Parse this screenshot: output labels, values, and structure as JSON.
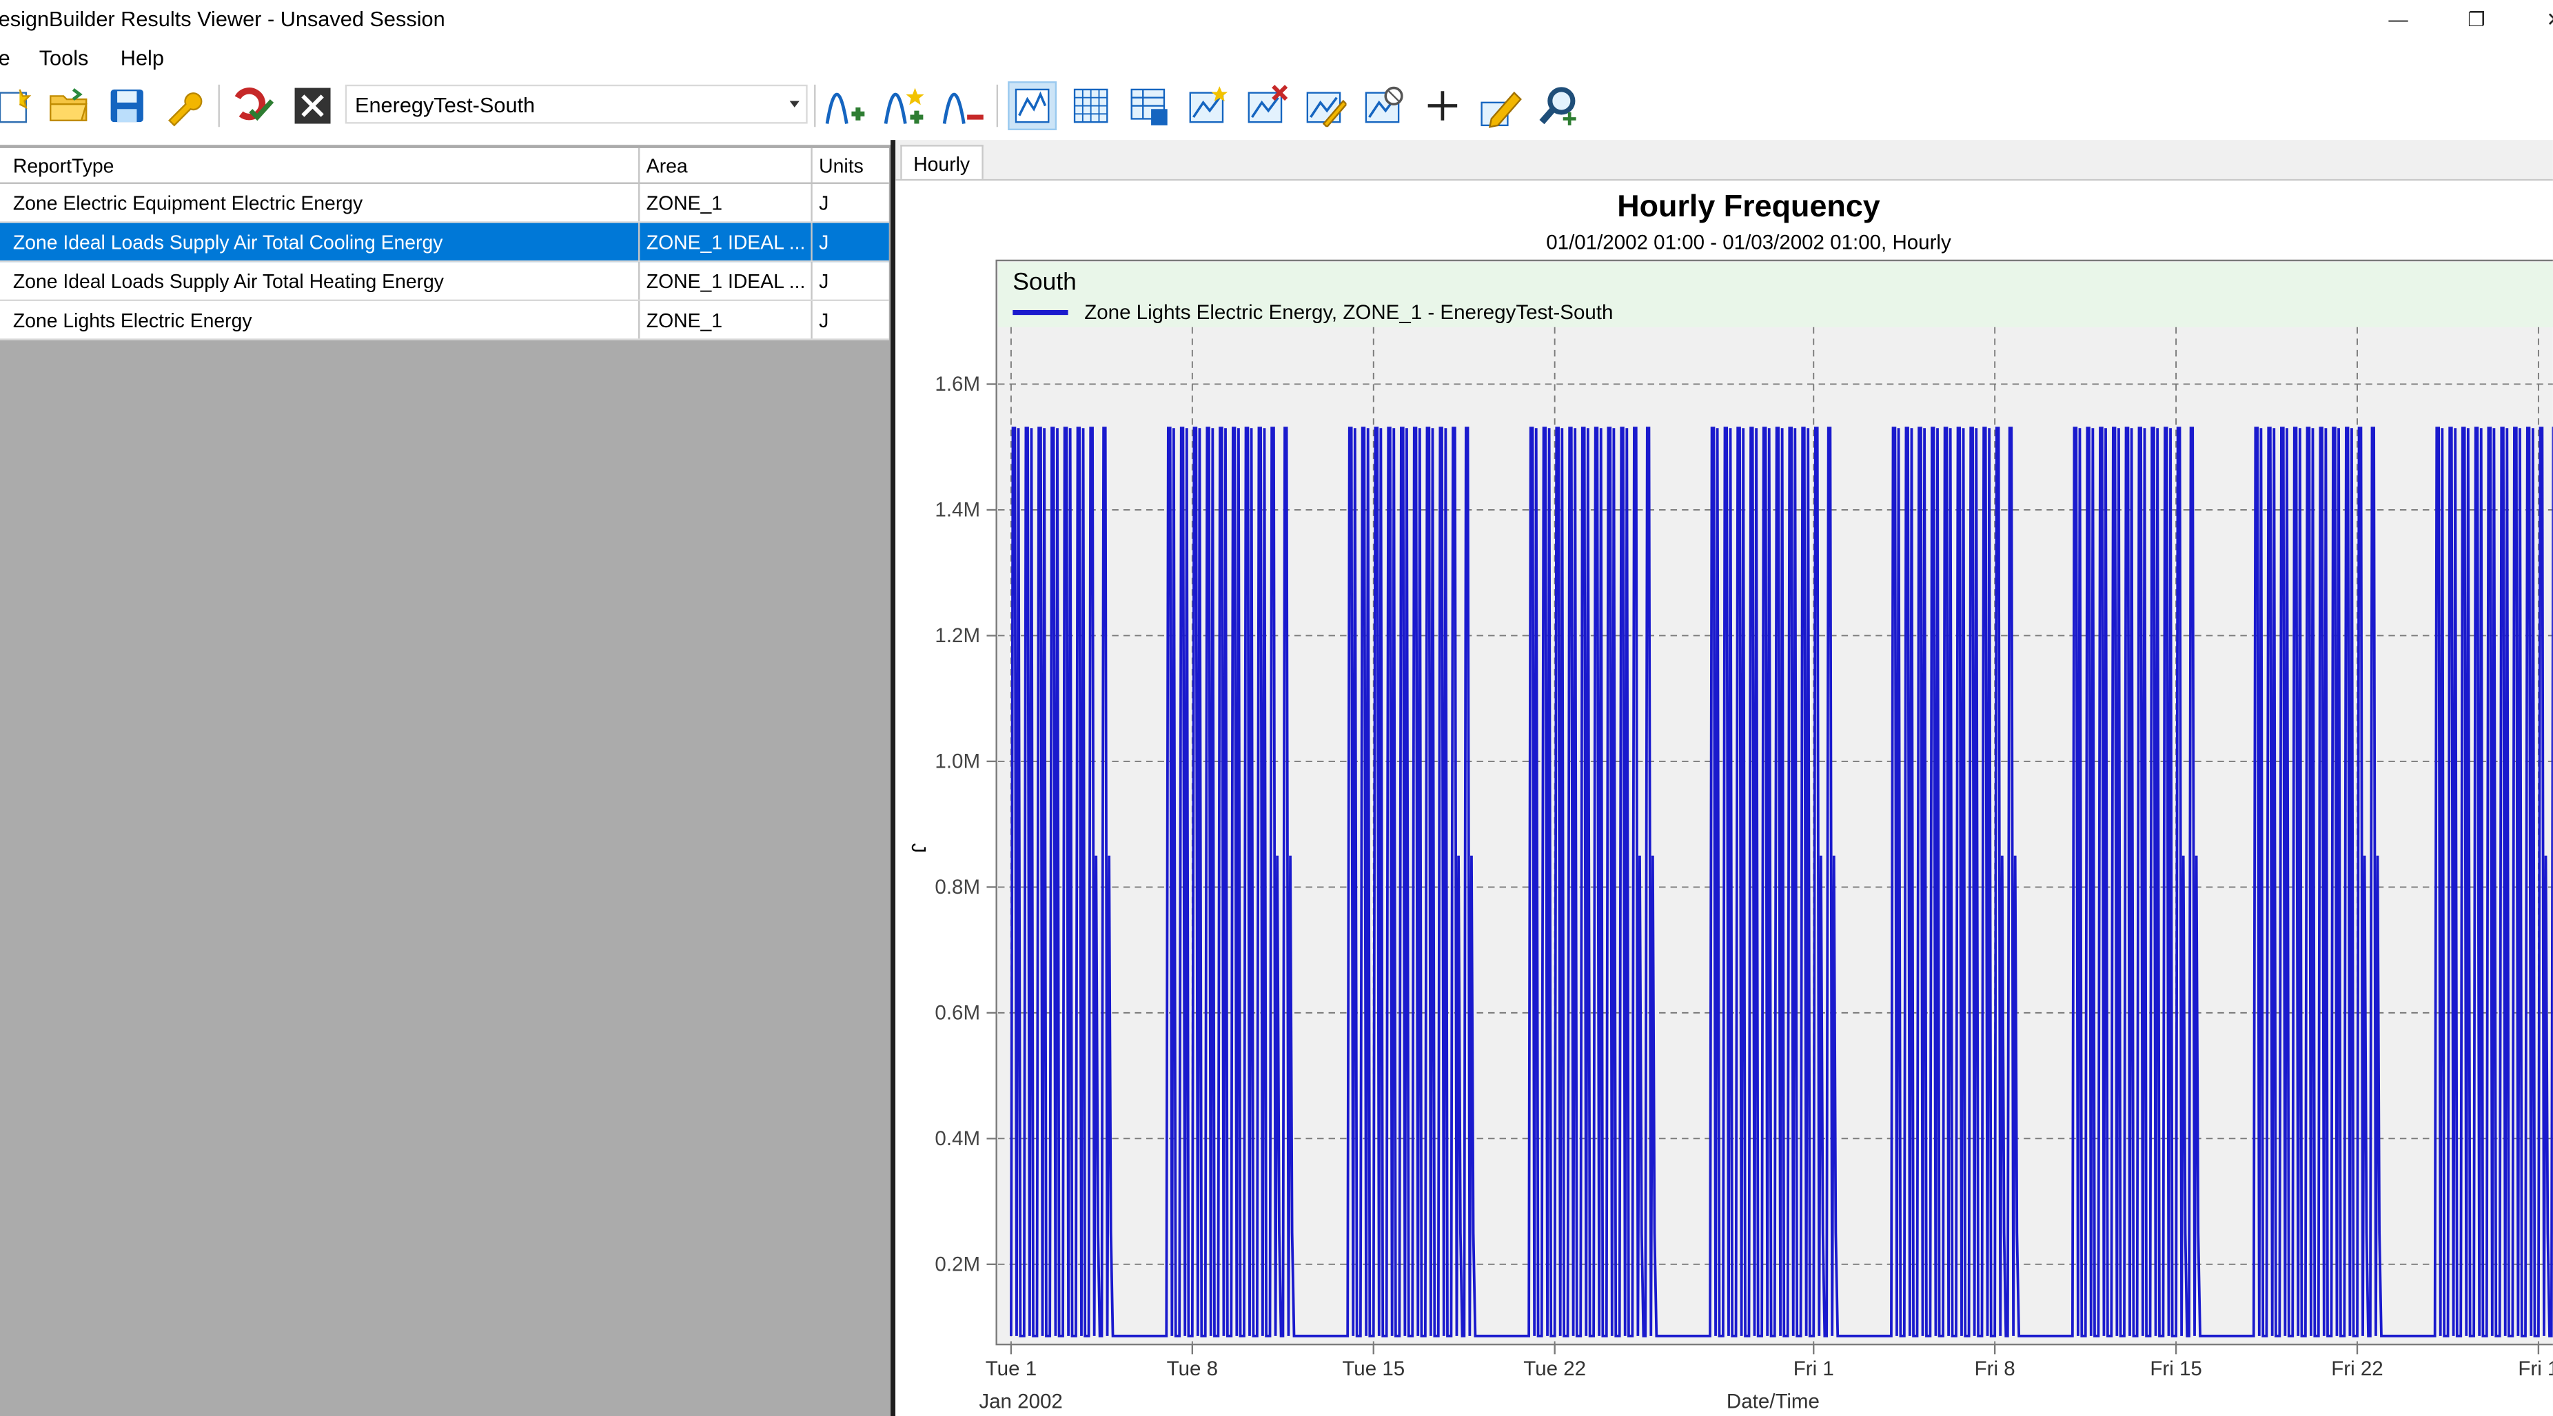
{
  "window": {
    "title": "esignBuilder Results Viewer - Unsaved Session",
    "minimize_glyph": "—",
    "restore_glyph": "❐",
    "close_glyph": "✕"
  },
  "menu": {
    "file_partial": "e",
    "tools": "Tools",
    "help": "Help"
  },
  "toolbar": {
    "dataset_selected": "EneregyTest-South",
    "icons": [
      "new-icon",
      "open-folder-icon",
      "save-icon",
      "settings-wrench-icon",
      "refresh-check-icon",
      "close-x-icon",
      "add-series-icon",
      "add-series-star-icon",
      "remove-series-icon",
      "line-chart-icon",
      "grid-table-icon",
      "data-table-icon",
      "new-chart-icon",
      "delete-chart-icon",
      "edit-chart-icon",
      "chart-options-icon",
      "crosshair-icon",
      "edit-pencil-icon",
      "zoom-search-icon"
    ]
  },
  "grid": {
    "columns": [
      "ReportType",
      "Area",
      "Units"
    ],
    "rows": [
      {
        "report": "Zone Electric Equipment Electric Energy",
        "area": "ZONE_1",
        "units": "J",
        "selected": false
      },
      {
        "report": "Zone Ideal Loads Supply Air Total Cooling Energy",
        "area": "ZONE_1 IDEAL ...",
        "units": "J",
        "selected": true
      },
      {
        "report": "Zone Ideal Loads Supply Air Total Heating Energy",
        "area": "ZONE_1 IDEAL ...",
        "units": "J",
        "selected": false
      },
      {
        "report": "Zone Lights Electric Energy",
        "area": "ZONE_1",
        "units": "J",
        "selected": false
      }
    ]
  },
  "tabs": [
    {
      "label": "Hourly",
      "active": true
    }
  ],
  "colors": {
    "series": "#1a1acd",
    "selection": "#0078d7",
    "legend_bg": "#e9f6e9",
    "plot_bg": "#f0f0f0"
  },
  "chart_data": {
    "type": "line",
    "title": "Hourly Frequency",
    "subtitle": "01/01/2002 01:00 - 01/03/2002 01:00, Hourly",
    "legend_title": "South",
    "xlabel": "Date/Time",
    "ylabel": "J",
    "x_start_label": "Jan 2002",
    "y_ticks": [
      "1.6M",
      "1.4M",
      "1.2M",
      "1.0M",
      "0.8M",
      "0.6M",
      "0.4M",
      "0.2M"
    ],
    "y_tick_values": [
      1600000,
      1400000,
      1200000,
      1000000,
      800000,
      600000,
      400000,
      200000
    ],
    "ylim": [
      0,
      1600000
    ],
    "x_ticks": [
      "Tue 1",
      "Tue 8",
      "Tue 15",
      "Tue 22",
      "Fri 1",
      "Fri 8",
      "Fri 15",
      "Fri 22",
      "Fri 1"
    ],
    "x_tick_dates": [
      "2002-01-01",
      "2002-01-08",
      "2002-01-15",
      "2002-01-22",
      "2002-02-01",
      "2002-02-08",
      "2002-02-15",
      "2002-02-22",
      "2002-03-01"
    ],
    "xlim": [
      "2002-01-01",
      "2002-03-01"
    ],
    "grid": true,
    "legend_position": "top",
    "series": [
      {
        "name": "Zone Lights Electric Energy, ZONE_1 - EneregyTest-South",
        "pattern": "weekly",
        "weekday_values": [
          86000,
          1530000,
          1530000,
          86000,
          1530000,
          86000,
          86000
        ],
        "friday_values": [
          86000,
          1530000,
          1530000,
          86000,
          850000,
          250000,
          86000
        ],
        "weekend_values": [
          86000
        ],
        "start_weekday": "Tuesday"
      }
    ]
  }
}
